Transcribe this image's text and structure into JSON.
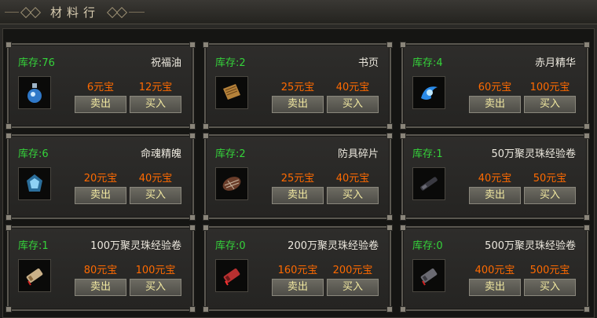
{
  "window": {
    "title": "材料行"
  },
  "items": [
    {
      "stock": "库存:76",
      "name": "祝福油",
      "sell_price": "6元宝",
      "buy_price": "12元宝",
      "sell_label": "卖出",
      "buy_label": "买入",
      "icon": "blessing-oil-icon",
      "icon_color": "#6ab8ff"
    },
    {
      "stock": "库存:2",
      "name": "书页",
      "sell_price": "25元宝",
      "buy_price": "40元宝",
      "sell_label": "卖出",
      "buy_label": "买入",
      "icon": "book-page-icon",
      "icon_color": "#b5823a"
    },
    {
      "stock": "库存:4",
      "name": "赤月精华",
      "sell_price": "60元宝",
      "buy_price": "100元宝",
      "sell_label": "卖出",
      "buy_label": "买入",
      "icon": "red-moon-essence-icon",
      "icon_color": "#3aa8ff"
    },
    {
      "stock": "库存:6",
      "name": "命魂精魄",
      "sell_price": "20元宝",
      "buy_price": "40元宝",
      "sell_label": "卖出",
      "buy_label": "买入",
      "icon": "soul-essence-icon",
      "icon_color": "#5fb6e8"
    },
    {
      "stock": "库存:2",
      "name": "防具碎片",
      "sell_price": "25元宝",
      "buy_price": "40元宝",
      "sell_label": "卖出",
      "buy_label": "买入",
      "icon": "armor-fragment-icon",
      "icon_color": "#8a5a3a"
    },
    {
      "stock": "库存:1",
      "name": "50万聚灵珠经验卷",
      "sell_price": "40元宝",
      "buy_price": "50元宝",
      "sell_label": "卖出",
      "buy_label": "买入",
      "icon": "exp-scroll-icon",
      "icon_color": "#404048"
    },
    {
      "stock": "库存:1",
      "name": "100万聚灵珠经验卷",
      "sell_price": "80元宝",
      "buy_price": "100元宝",
      "sell_label": "卖出",
      "buy_label": "买入",
      "icon": "exp-scroll-icon",
      "icon_color": "#c9b088"
    },
    {
      "stock": "库存:0",
      "name": "200万聚灵珠经验卷",
      "sell_price": "160元宝",
      "buy_price": "200元宝",
      "sell_label": "卖出",
      "buy_label": "买入",
      "icon": "exp-scroll-icon",
      "icon_color": "#b83030"
    },
    {
      "stock": "库存:0",
      "name": "500万聚灵珠经验卷",
      "sell_price": "400元宝",
      "buy_price": "500元宝",
      "sell_label": "卖出",
      "buy_label": "买入",
      "icon": "exp-scroll-icon",
      "icon_color": "#6a6a72"
    }
  ],
  "colors": {
    "stock": "#35d33a",
    "price": "#ff6a00",
    "button_text": "#f1e8a0"
  }
}
